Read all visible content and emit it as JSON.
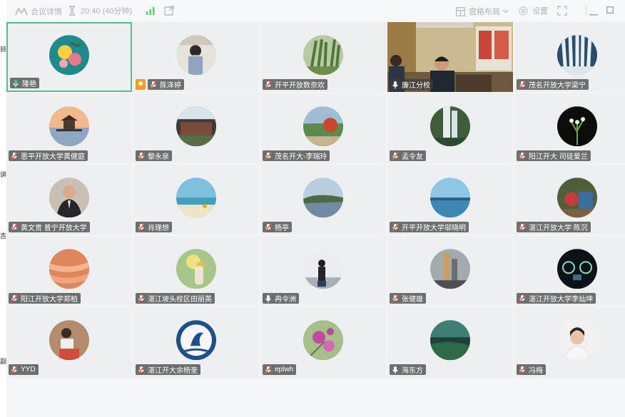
{
  "titlebar": {
    "meeting_info": "会议详情",
    "timer": "20:40 (40分钟)",
    "layout": "宫格布局",
    "settings": "设置"
  },
  "participants": [
    {
      "name": "隆艳",
      "mic": "on",
      "active": true
    },
    {
      "name": "陈泽婷",
      "mic": "muted",
      "host": true
    },
    {
      "name": "开平开放数奈欢",
      "mic": "muted"
    },
    {
      "name": "廉江分校",
      "mic": "on",
      "video": true
    },
    {
      "name": "茂名开放大学梁宁",
      "mic": "muted"
    },
    {
      "name": "恩平开放大学黄健庭",
      "mic": "muted"
    },
    {
      "name": "黎永泉",
      "mic": "muted"
    },
    {
      "name": "茂名开大-李瑞玲",
      "mic": "muted"
    },
    {
      "name": "孟令友",
      "mic": "muted"
    },
    {
      "name": "阳江开大  司徒爱兰",
      "mic": "muted"
    },
    {
      "name": "黄文贵 普宁开放大学",
      "mic": "muted"
    },
    {
      "name": "肖理想",
      "mic": "muted"
    },
    {
      "name": "杨亭",
      "mic": "muted"
    },
    {
      "name": "开平开放大学邬晓明",
      "mic": "muted"
    },
    {
      "name": "湛江开放大学 陈沉",
      "mic": "muted"
    },
    {
      "name": "阳江开放大学郑柏",
      "mic": "muted"
    },
    {
      "name": "湛江坡头校区田丽英",
      "mic": "muted"
    },
    {
      "name": "冉令洲",
      "mic": "on"
    },
    {
      "name": "张健雄",
      "mic": "muted"
    },
    {
      "name": "湛江开放大学李灿坤",
      "mic": "muted"
    },
    {
      "name": "YYD",
      "mic": "muted"
    },
    {
      "name": "湛江开大余杨奎",
      "mic": "muted"
    },
    {
      "name": "eplwh",
      "mic": "muted"
    },
    {
      "name": "海东方",
      "mic": "on"
    },
    {
      "name": "冯梅",
      "mic": "muted"
    }
  ],
  "colors": {
    "active_border": "#4cc38a",
    "host_badge": "#f59a23",
    "mic_on": "#ffffff",
    "mic_muted": "#ff5a50"
  },
  "edge_text": [
    "目",
    "讲",
    "吉",
    "副"
  ]
}
